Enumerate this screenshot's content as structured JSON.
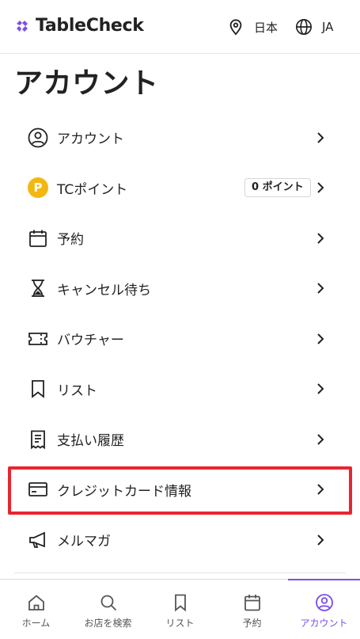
{
  "header": {
    "logo_text": "TableCheck",
    "brand_color": "#7a4ee8",
    "region_label": "日本",
    "region_icon": "location-pin-icon",
    "language_label": "JA",
    "language_icon": "globe-icon"
  },
  "page": {
    "title": "アカウント"
  },
  "menu": {
    "items": [
      {
        "label": "アカウント",
        "icon": "user-circle-icon"
      },
      {
        "label": "TCポイント",
        "icon": "points-coin-icon",
        "coin_letter": "P",
        "badge": "0 ポイント"
      },
      {
        "label": "予約",
        "icon": "calendar-icon"
      },
      {
        "label": "キャンセル待ち",
        "icon": "hourglass-icon"
      },
      {
        "label": "バウチャー",
        "icon": "ticket-icon"
      },
      {
        "label": "リスト",
        "icon": "bookmark-icon"
      },
      {
        "label": "支払い履歴",
        "icon": "receipt-icon"
      },
      {
        "label": "クレジットカード情報",
        "icon": "credit-card-icon",
        "highlighted": true,
        "highlight_color": "#e8252f"
      },
      {
        "label": "メルマガ",
        "icon": "megaphone-icon"
      }
    ]
  },
  "bottom_nav": {
    "tabs": [
      {
        "label": "ホーム",
        "icon": "home-icon"
      },
      {
        "label": "お店を検索",
        "icon": "search-icon"
      },
      {
        "label": "リスト",
        "icon": "bookmark-icon"
      },
      {
        "label": "予約",
        "icon": "calendar-icon"
      },
      {
        "label": "アカウント",
        "icon": "user-circle-icon",
        "active": true
      }
    ]
  }
}
